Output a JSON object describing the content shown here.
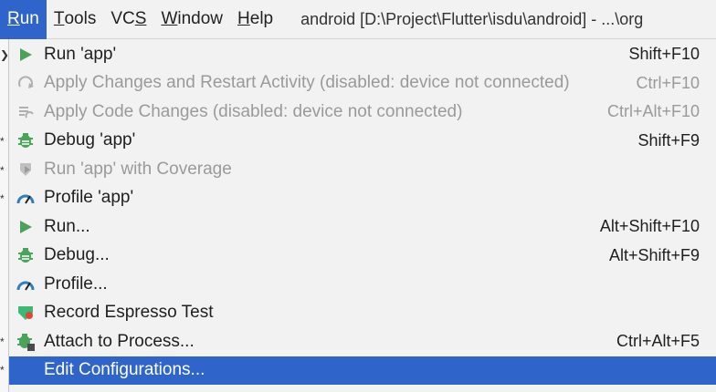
{
  "menubar": {
    "items": [
      {
        "mnemonic": "R",
        "rest": "un"
      },
      {
        "mnemonic": "T",
        "rest": "ools"
      },
      {
        "pre": "VC",
        "mnemonic": "S"
      },
      {
        "mnemonic": "W",
        "rest": "indow"
      },
      {
        "mnemonic": "H",
        "rest": "elp"
      }
    ],
    "window_title": "android [D:\\Project\\Flutter\\isdu\\android] - ...\\org"
  },
  "menu": {
    "items": [
      {
        "label": "Run 'app'",
        "shortcut": "Shift+F10",
        "icon": "run-icon",
        "enabled": true
      },
      {
        "label": "Apply Changes and Restart Activity (disabled: device not connected)",
        "shortcut": "Ctrl+F10",
        "icon": "apply-changes-icon",
        "enabled": false
      },
      {
        "label": "Apply Code Changes (disabled: device not connected)",
        "shortcut": "Ctrl+Alt+F10",
        "icon": "apply-code-changes-icon",
        "enabled": false
      },
      {
        "label": "Debug 'app'",
        "shortcut": "Shift+F9",
        "icon": "debug-icon",
        "enabled": true
      },
      {
        "label": "Run 'app' with Coverage",
        "shortcut": "",
        "icon": "coverage-icon",
        "enabled": false
      },
      {
        "label": "Profile 'app'",
        "shortcut": "",
        "icon": "profile-icon",
        "enabled": true
      },
      {
        "label": "Run...",
        "shortcut": "Alt+Shift+F10",
        "icon": "run-icon",
        "enabled": true
      },
      {
        "label": "Debug...",
        "shortcut": "Alt+Shift+F9",
        "icon": "debug-icon",
        "enabled": true
      },
      {
        "label": "Profile...",
        "shortcut": "",
        "icon": "profile-icon",
        "enabled": true
      },
      {
        "label": "Record Espresso Test",
        "shortcut": "",
        "icon": "espresso-icon",
        "enabled": true
      },
      {
        "label": "Attach to Process...",
        "shortcut": "Ctrl+Alt+F5",
        "icon": "attach-process-icon",
        "enabled": true
      },
      {
        "label": "Edit Configurations...",
        "shortcut": "",
        "icon": "",
        "enabled": true,
        "selected": true
      }
    ]
  },
  "colors": {
    "accent": "#2f65ca",
    "run_green": "#4aa35a",
    "profile_blue": "#2f7fbf",
    "disabled_text": "#9a9a9a"
  }
}
